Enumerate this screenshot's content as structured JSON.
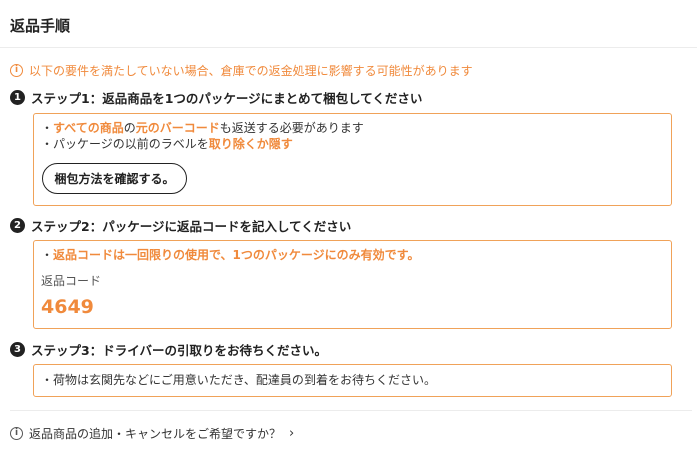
{
  "header": {
    "title": "返品手順"
  },
  "notice": {
    "text": "以下の要件を満たしていない場合、倉庫での返金処理に影響する可能性があります"
  },
  "step1": {
    "number": "1",
    "title": "ステップ1：返品商品を1つのパッケージにまとめて梱包してください",
    "line1": {
      "bullet": "・",
      "highlight1": "すべての商品",
      "text1": "の",
      "highlight2": "元のバーコード",
      "text2": "も返送する必要があります"
    },
    "line2": {
      "bullet": "・",
      "text1": "パッケージの以前のラベルを",
      "highlight1": "取り除くか隠す"
    },
    "button_label": "梱包方法を確認する。"
  },
  "step2": {
    "number": "2",
    "title": "ステップ2：パッケージに返品コードを記入してください",
    "line1": {
      "bullet": "・",
      "highlight1": "返品コードは一回限りの使用で、1つのパッケージにのみ有効です。"
    },
    "code_label": "返品コード",
    "code_value": "4649"
  },
  "step3": {
    "number": "3",
    "title": "ステップ3：ドライバーの引取りをお待ちください。",
    "line1": {
      "bullet": "・",
      "text1": "荷物は玄関先などにご用意いただき、配達員の到着をお待ちください。"
    }
  },
  "footer": {
    "text": "返品商品の追加・キャンセルをご希望ですか？",
    "chevron": "›"
  },
  "icons": {
    "info": "info-icon",
    "chevron": "chevron-right-icon"
  },
  "colors": {
    "accent": "#f08a3c",
    "box_border": "#f0a259",
    "text": "#222222"
  }
}
